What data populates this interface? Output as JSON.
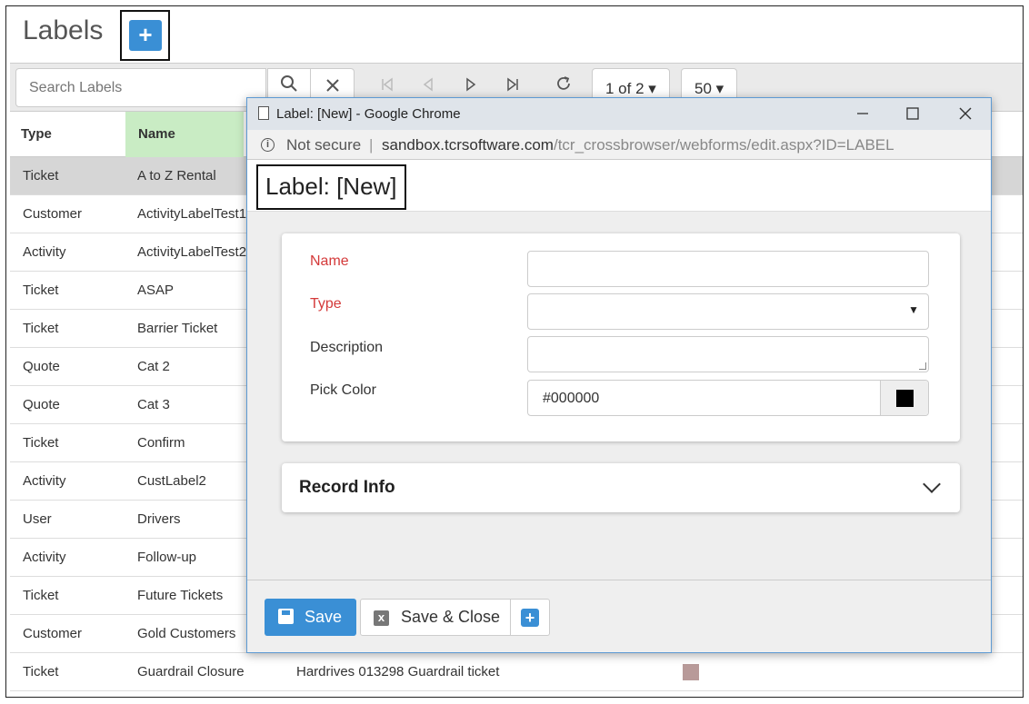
{
  "page": {
    "title": "Labels",
    "add_label": "+"
  },
  "toolbar": {
    "search_placeholder": "Search Labels",
    "pager": "1 of 2 ▾",
    "page_size": "50 ▾",
    "icons": [
      "search-icon",
      "clear-icon",
      "first-page-icon",
      "prev-page-icon",
      "next-page-icon",
      "last-page-icon",
      "refresh-icon"
    ]
  },
  "grid": {
    "columns": [
      "Type",
      "Name"
    ],
    "rows": [
      {
        "type": "Ticket",
        "name": "A to Z Rental",
        "selected": true
      },
      {
        "type": "Customer",
        "name": "ActivityLabelTest1"
      },
      {
        "type": "Activity",
        "name": "ActivityLabelTest2"
      },
      {
        "type": "Ticket",
        "name": "ASAP"
      },
      {
        "type": "Ticket",
        "name": "Barrier Ticket"
      },
      {
        "type": "Quote",
        "name": "Cat 2"
      },
      {
        "type": "Quote",
        "name": "Cat 3"
      },
      {
        "type": "Ticket",
        "name": "Confirm"
      },
      {
        "type": "Activity",
        "name": "CustLabel2"
      },
      {
        "type": "User",
        "name": "Drivers"
      },
      {
        "type": "Activity",
        "name": "Follow-up"
      },
      {
        "type": "Ticket",
        "name": "Future Tickets"
      },
      {
        "type": "Customer",
        "name": "Gold Customers"
      },
      {
        "type": "Ticket",
        "name": "Guardrail Closure",
        "description": "Hardrives 013298 Guardrail ticket",
        "color": "#b89a99"
      }
    ]
  },
  "popup": {
    "window_title": "Label: [New] - Google Chrome",
    "not_secure": "Not secure",
    "separator": "|",
    "url_host": "sandbox.tcrsoftware.com",
    "url_path": "/tcr_crossbrowser/webforms/edit.aspx?ID=LABEL",
    "heading": "Label: [New]",
    "form": {
      "name_label": "Name",
      "type_label": "Type",
      "description_label": "Description",
      "pick_color_label": "Pick Color",
      "color_value": "#000000",
      "name_value": "",
      "type_value": "",
      "description_value": ""
    },
    "record_info_label": "Record Info",
    "buttons": {
      "save": "Save",
      "save_close": "Save & Close",
      "add": "+"
    }
  },
  "colors": {
    "accent": "#3a8fd5",
    "required": "#d43a3a",
    "name_header_bg": "#c9ecc4",
    "selected_row": "#d6d6d6",
    "picked_color": "#000000"
  }
}
